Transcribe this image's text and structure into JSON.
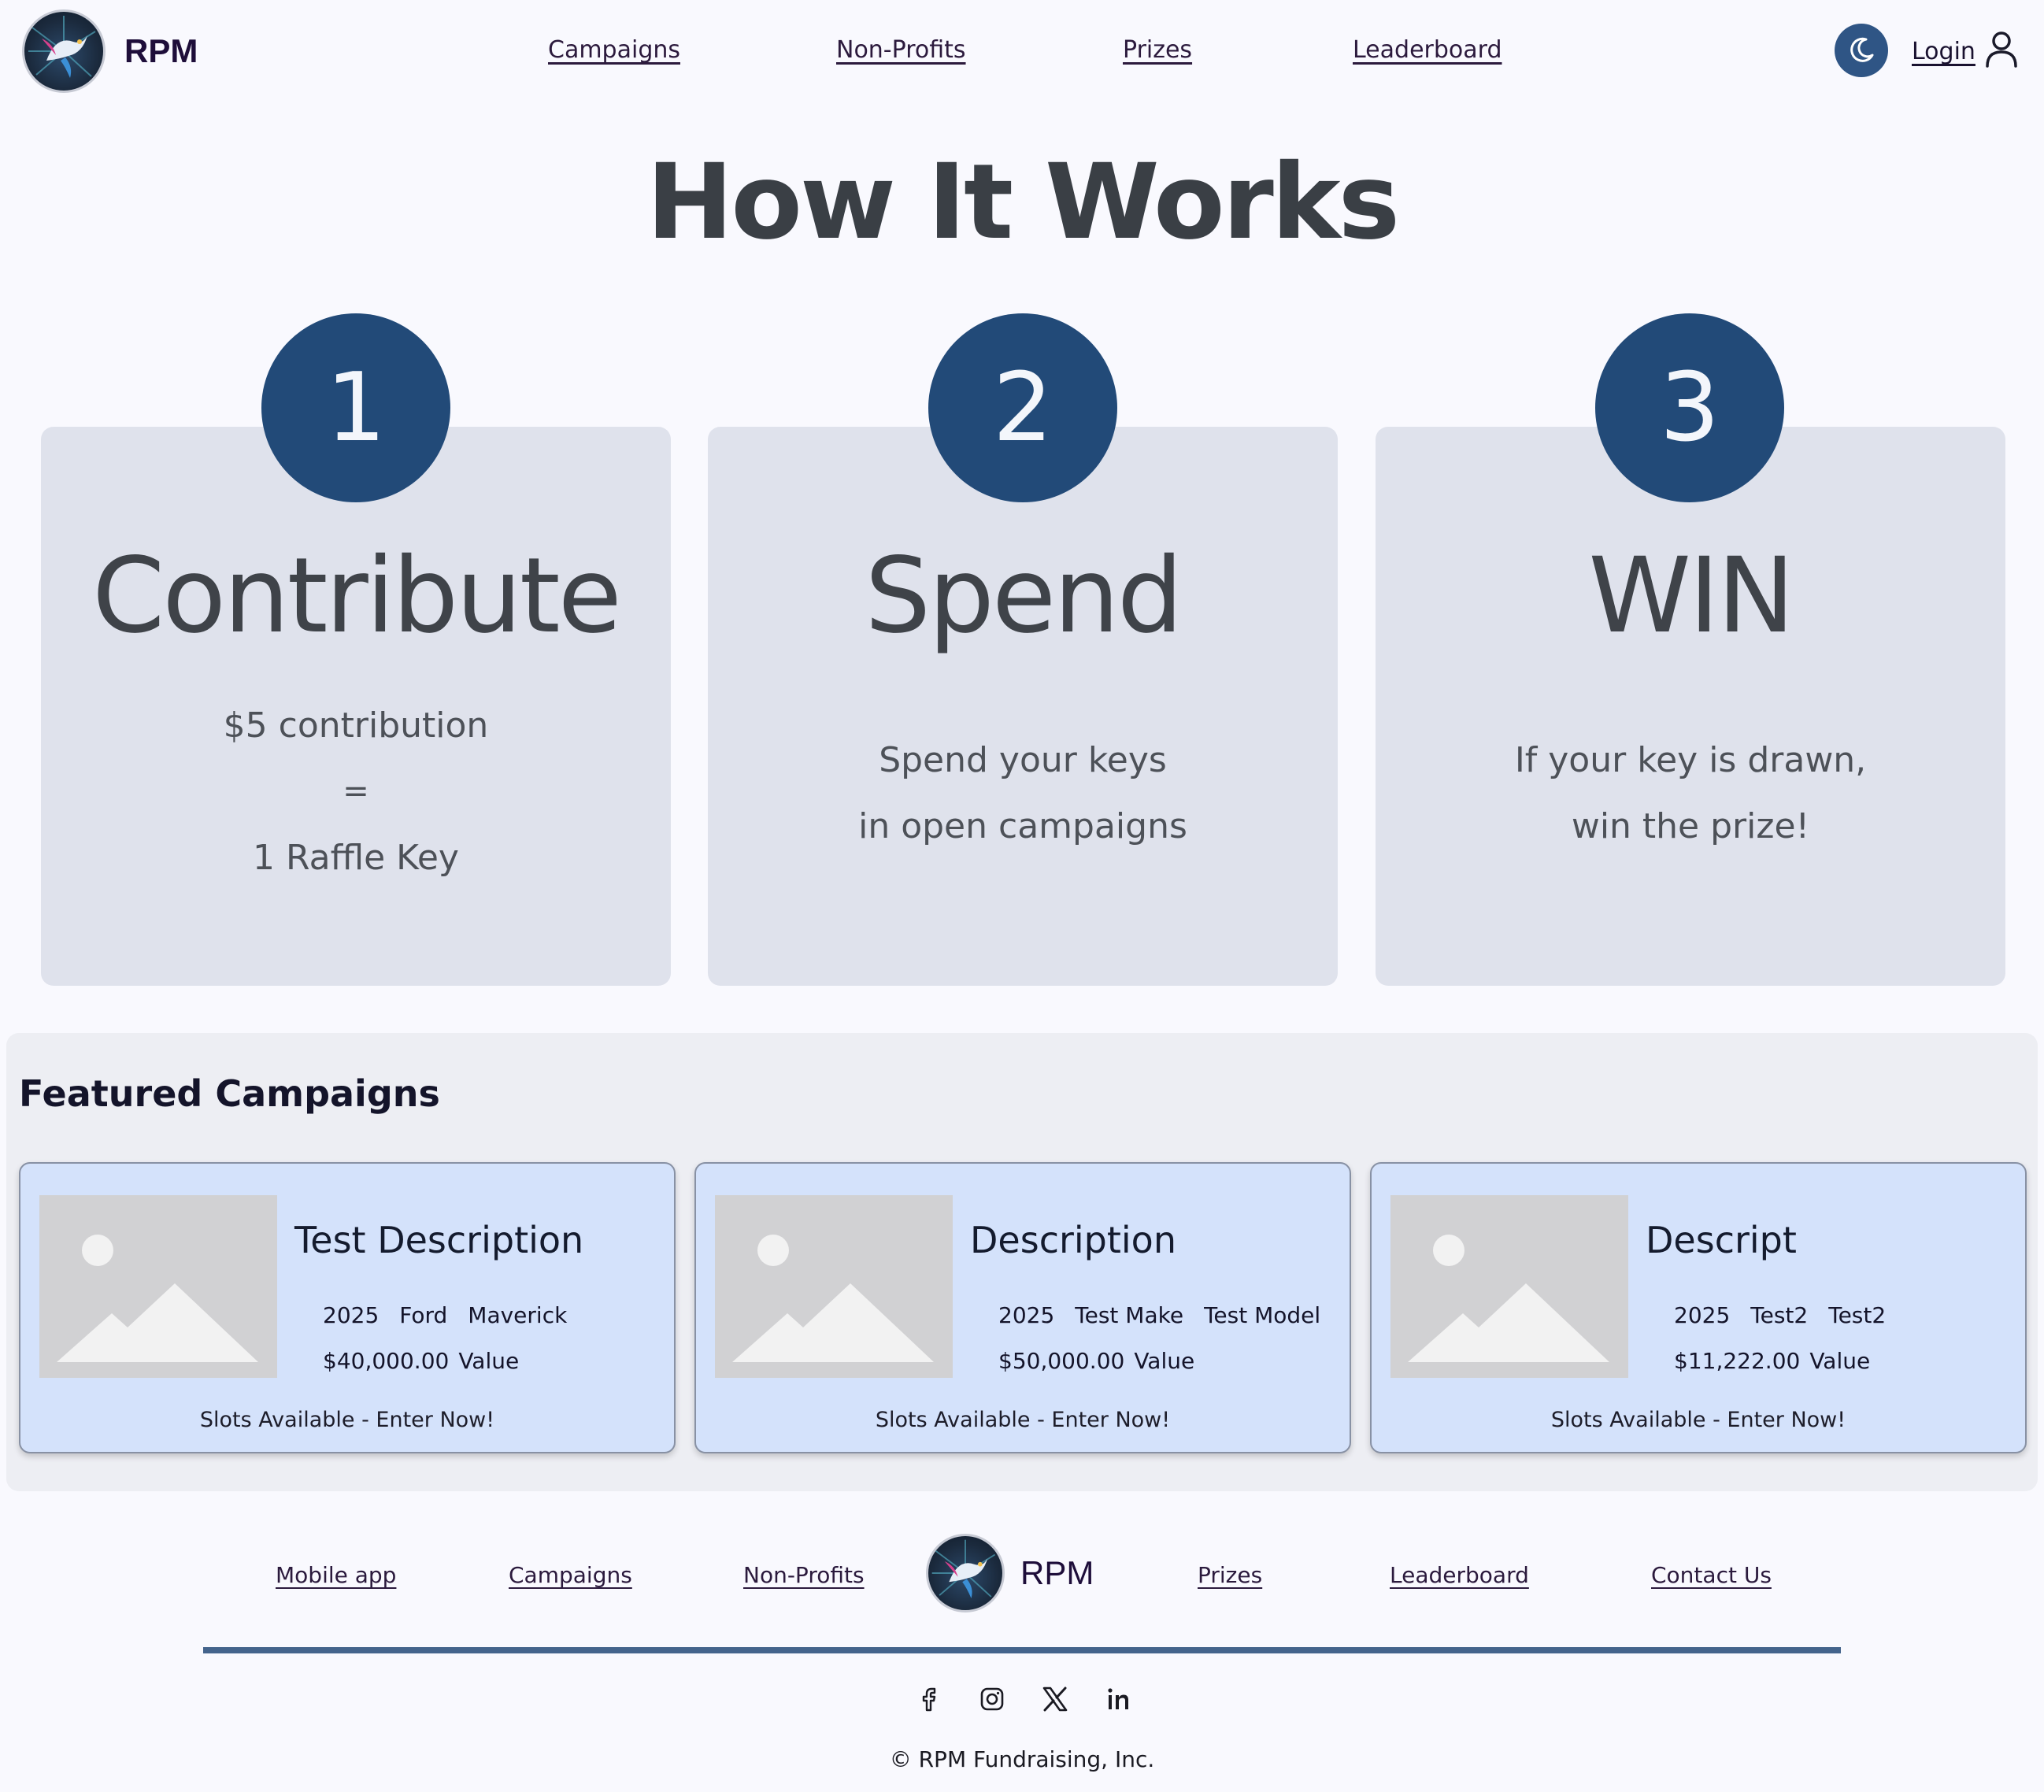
{
  "header": {
    "brand": "RPM",
    "nav": [
      "Campaigns",
      "Non-Profits",
      "Prizes",
      "Leaderboard"
    ],
    "login": "Login"
  },
  "how_it_works": {
    "title": "How It Works",
    "steps": [
      {
        "number": "1",
        "title": "Contribute",
        "lines": [
          "$5 contribution",
          "=",
          "1 Raffle Key"
        ]
      },
      {
        "number": "2",
        "title": "Spend",
        "lines": [
          "Spend your keys",
          "in open campaigns"
        ]
      },
      {
        "number": "3",
        "title": "WIN",
        "lines": [
          "If your key is drawn,",
          "win the prize!"
        ]
      }
    ]
  },
  "featured": {
    "title": "Featured Campaigns",
    "campaigns": [
      {
        "title": "Test Description",
        "year": "2025",
        "make": "Ford",
        "model": "Maverick",
        "value": "$40,000.00",
        "value_label": "Value",
        "status": "Slots Available - Enter Now!"
      },
      {
        "title": "Description",
        "year": "2025",
        "make": "Test Make",
        "model": "Test Model",
        "value": "$50,000.00",
        "value_label": "Value",
        "status": "Slots Available - Enter Now!"
      },
      {
        "title": "Descript",
        "year": "2025",
        "make": "Test2",
        "model": "Test2",
        "value": "$11,222.00",
        "value_label": "Value",
        "status": "Slots Available - Enter Now!"
      }
    ]
  },
  "footer": {
    "links_left": [
      "Mobile app",
      "Campaigns",
      "Non-Profits"
    ],
    "brand": "RPM",
    "links_right": [
      "Prizes",
      "Leaderboard",
      "Contact Us"
    ],
    "social": [
      "facebook-icon",
      "instagram-icon",
      "x-icon",
      "linkedin-icon"
    ],
    "copyright": "© RPM Fundraising, Inc."
  },
  "colors": {
    "primary": "#224a78",
    "card": "#dfe2ec",
    "campaign_card": "#d4e2fb",
    "rule": "#44648c"
  }
}
